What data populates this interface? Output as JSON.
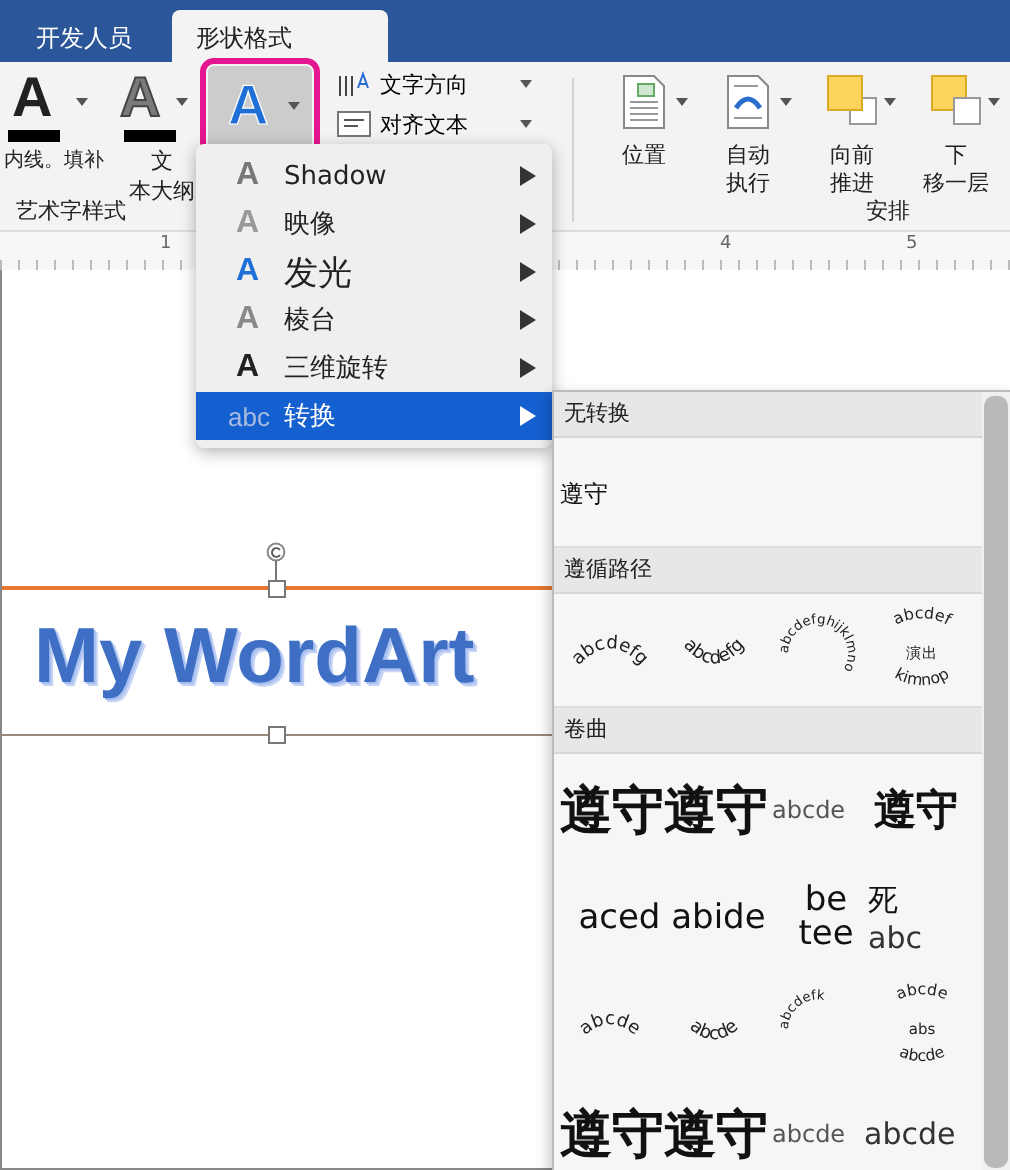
{
  "tabs": [
    {
      "label": "开发人员",
      "selected": false
    },
    {
      "label": "形状格式",
      "selected": true
    }
  ],
  "ribbon": {
    "wordart_group": {
      "buttons": [
        {
          "glyph": "A",
          "kind": "fill",
          "label_lines": [
            "内线。填补"
          ],
          "selected": false
        },
        {
          "glyph": "A",
          "kind": "outline",
          "label_lines": [
            "文",
            "本大纲"
          ],
          "selected": false
        },
        {
          "glyph": "A",
          "kind": "effects",
          "selected": true
        }
      ],
      "group_label": "艺术字样式"
    },
    "text_commands": [
      {
        "label": "文字方向",
        "kind": "direction"
      },
      {
        "label": "对齐文本",
        "kind": "align"
      }
    ],
    "arrange_group": {
      "buttons": [
        {
          "kind": "position",
          "label_lines": [
            "位置"
          ]
        },
        {
          "kind": "wrap",
          "label_lines": [
            "自动",
            "执行"
          ]
        },
        {
          "kind": "forward",
          "label_lines": [
            "向前",
            "推进"
          ]
        },
        {
          "kind": "backward",
          "label_lines": [
            "下",
            "移一层"
          ]
        }
      ],
      "group_label": "安排"
    }
  },
  "ruler": {
    "marks": [
      "1",
      "4",
      "5"
    ]
  },
  "document": {
    "wordart_text": "My WordArt"
  },
  "effects_menu": {
    "items": [
      {
        "icon": "A",
        "kind": "shadow",
        "label": "Shadow",
        "selected": false,
        "has_submenu": true
      },
      {
        "icon": "A",
        "kind": "reflection",
        "label": "映像",
        "selected": false,
        "has_submenu": true
      },
      {
        "icon": "A",
        "kind": "glow",
        "label": "发光",
        "selected": false,
        "has_submenu": true
      },
      {
        "icon": "A",
        "kind": "bevel",
        "label": "棱台",
        "selected": false,
        "has_submenu": true
      },
      {
        "icon": "A",
        "kind": "rotation",
        "label": "三维旋转",
        "selected": false,
        "has_submenu": true
      },
      {
        "icon": "abc",
        "kind": "transform",
        "label": "转换",
        "selected": true,
        "has_submenu": true
      }
    ]
  },
  "transform_gallery": {
    "sections": [
      {
        "title": "无转换",
        "items": [
          {
            "kind": "plain",
            "lines": [
              "遵守"
            ]
          }
        ]
      },
      {
        "title": "遵循路径",
        "items": [
          {
            "kind": "arc-up",
            "lines": [
              "abcdefg"
            ]
          },
          {
            "kind": "arc-down",
            "lines": [
              "abcdefg"
            ]
          },
          {
            "kind": "circle",
            "lines": [
              "abcdefghijklmno"
            ]
          },
          {
            "kind": "button",
            "lines": [
              "abcdef",
              "演出",
              "kimnop"
            ]
          }
        ]
      },
      {
        "title": "卷曲",
        "items": [
          {
            "kind": "big-pair",
            "lines": [
              "遵守遵守",
              "abcde"
            ]
          },
          {
            "kind": "big",
            "lines": [
              "遵守"
            ]
          },
          {
            "kind": "wide",
            "lines": [
              "aced abide"
            ]
          },
          {
            "kind": "stack",
            "lines": [
              "be",
              "tee"
            ]
          },
          {
            "kind": "over",
            "lines": [
              "死",
              "abc"
            ]
          },
          {
            "kind": "arc-up",
            "lines": [
              "abcde"
            ]
          },
          {
            "kind": "arc-down",
            "lines": [
              "abcde"
            ]
          },
          {
            "kind": "circle",
            "lines": [
              "abcdefk"
            ]
          },
          {
            "kind": "button",
            "lines": [
              "abcde",
              "abs",
              "abcde"
            ]
          },
          {
            "kind": "big-pair",
            "lines": [
              "遵守遵守",
              "abcde"
            ]
          },
          {
            "kind": "plain",
            "lines": [
              "abcde"
            ]
          }
        ]
      }
    ]
  }
}
